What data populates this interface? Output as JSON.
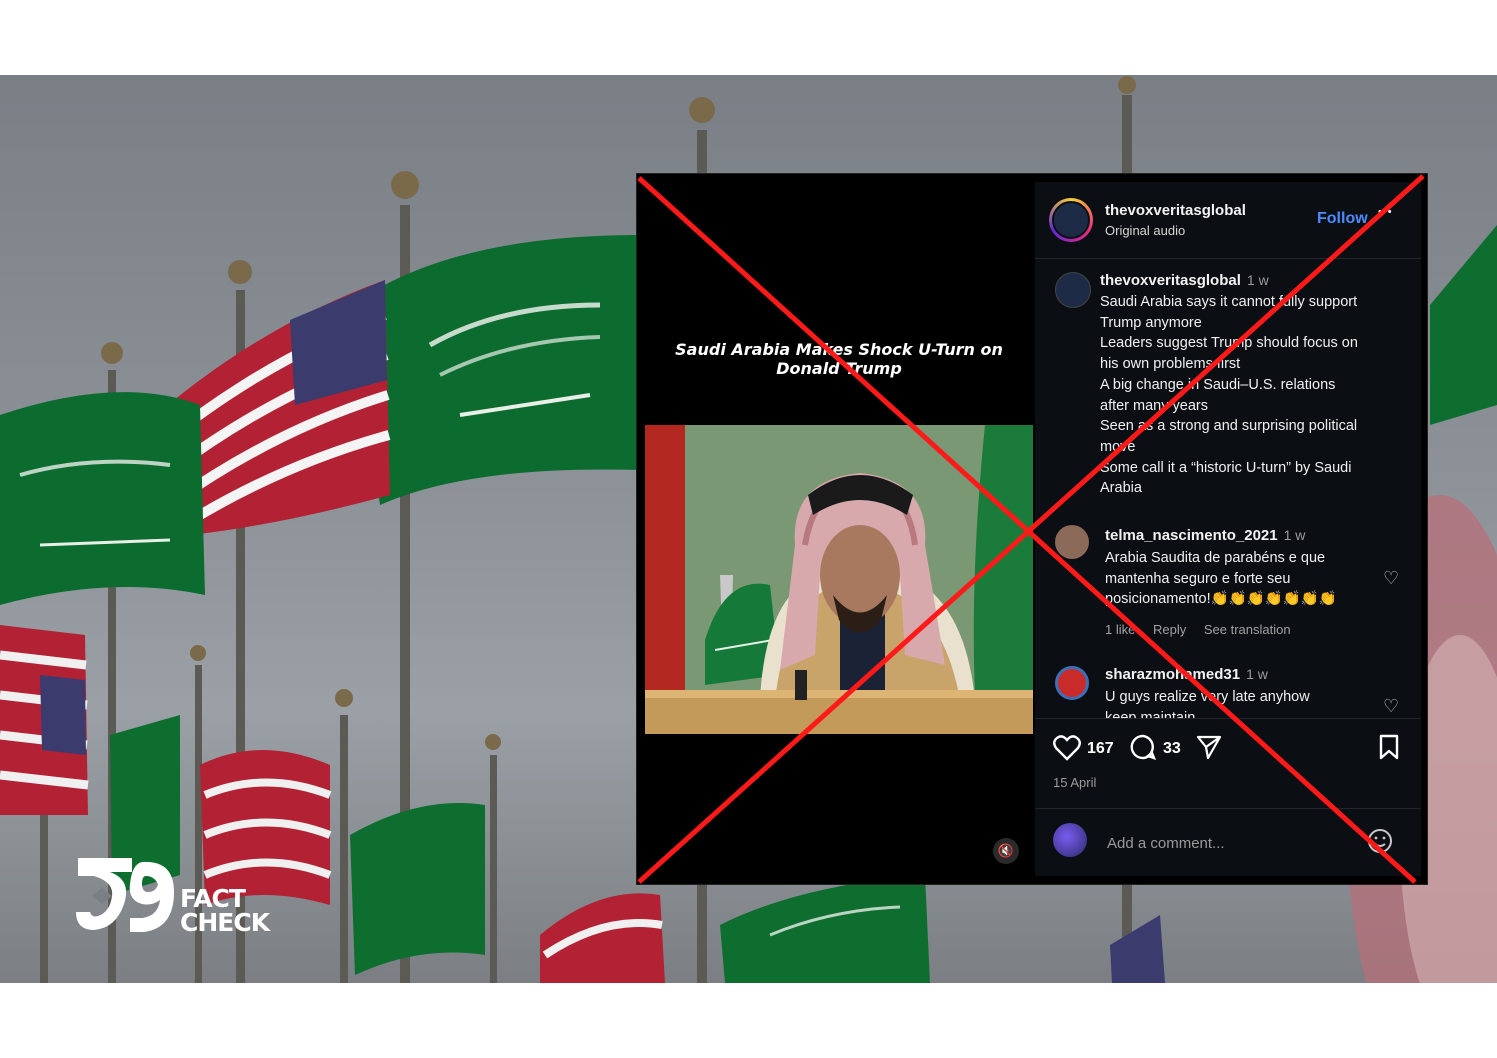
{
  "colors": {
    "cross": "#ff1a1a",
    "follow": "#4a8cff",
    "sa_green": "#0c6b2e",
    "us_red": "#b22234",
    "us_blue": "#3c3b6e"
  },
  "logo": {
    "fact": "FACT",
    "check": "CHECK"
  },
  "post": {
    "video_caption": "Saudi Arabia Makes Shock U-Turn on Donald Trump",
    "username": "thevoxveritasglobal",
    "audio": "Original audio",
    "follow": "Follow",
    "more": "•••",
    "caption": {
      "username": "thevoxveritasglobal",
      "time": "1 w",
      "lines": [
        "Saudi Arabia says it cannot fully support",
        "Trump anymore",
        "Leaders suggest Trump should focus on",
        "his own problems first",
        "A big change in Saudi–U.S. relations",
        "after many years",
        "Seen as a strong and surprising political",
        "move",
        "Some call it a “historic U-turn” by Saudi",
        "Arabia"
      ]
    },
    "comments": [
      {
        "username": "telma_nascimento_2021",
        "time": "1 w",
        "lines": [
          "Arabia Saudita de parabéns e que",
          "mantenha seguro e forte seu",
          "posicionamento!👏👏👏👏👏👏👏"
        ],
        "likes": "1 like",
        "reply": "Reply",
        "translate": "See translation"
      },
      {
        "username": "sharazmohamed31",
        "time": "1 w",
        "lines": [
          "U guys realize very late anyhow",
          "keep maintain"
        ]
      }
    ],
    "likes": "167",
    "comment_count": "33",
    "date": "15 April",
    "comment_placeholder": "Add a comment..."
  },
  "icons": [
    "heart-icon",
    "comment-icon",
    "share-icon",
    "bookmark-icon",
    "mute-icon",
    "emoji-icon",
    "more-icon"
  ]
}
